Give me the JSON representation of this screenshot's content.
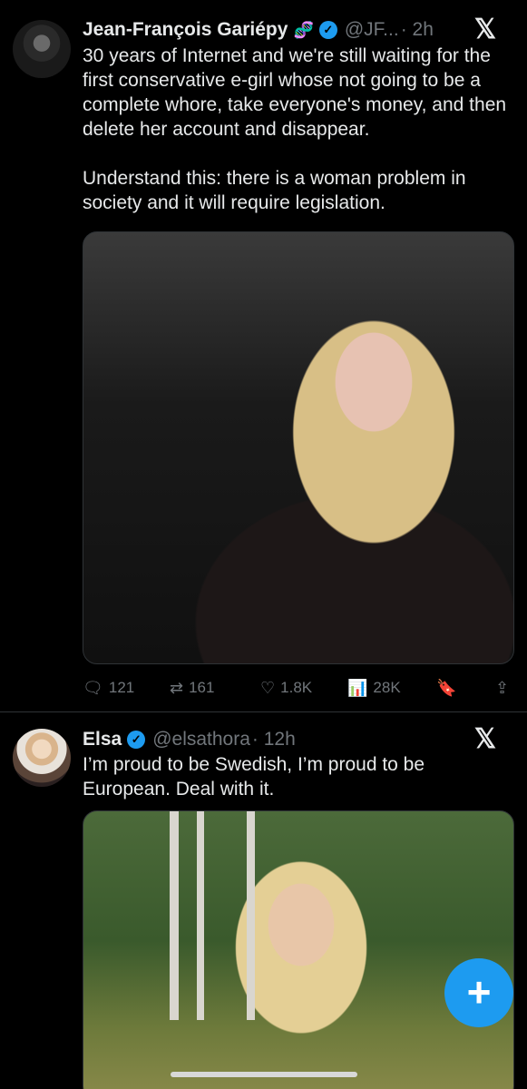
{
  "tweets": [
    {
      "name": "Jean-François Gariépy",
      "handle": "@JF...",
      "time": "· 2h",
      "badge_icon": "dna-emoji-icon",
      "text": "30 years of Internet and we're still waiting for the first conservative e-girl whose not going to be a complete whore, take everyone's money, and then delete her account and disappear.\n\nUnderstand this: there is a woman problem in society and it will require legislation.",
      "media": "photo",
      "actions": {
        "replies": "121",
        "retweets": "161",
        "likes": "1.8K",
        "views": "28K"
      }
    },
    {
      "name": "Elsa",
      "handle": "@elsathora",
      "time": "· 12h",
      "text": "I’m proud to be Swedish, I’m proud to be European. Deal with it.",
      "media": "photo"
    }
  ],
  "fab": {
    "label": "+"
  },
  "colors": {
    "accent": "#1d9bf0",
    "muted": "#71767b",
    "text": "#e7e9ea",
    "background": "#000000"
  }
}
